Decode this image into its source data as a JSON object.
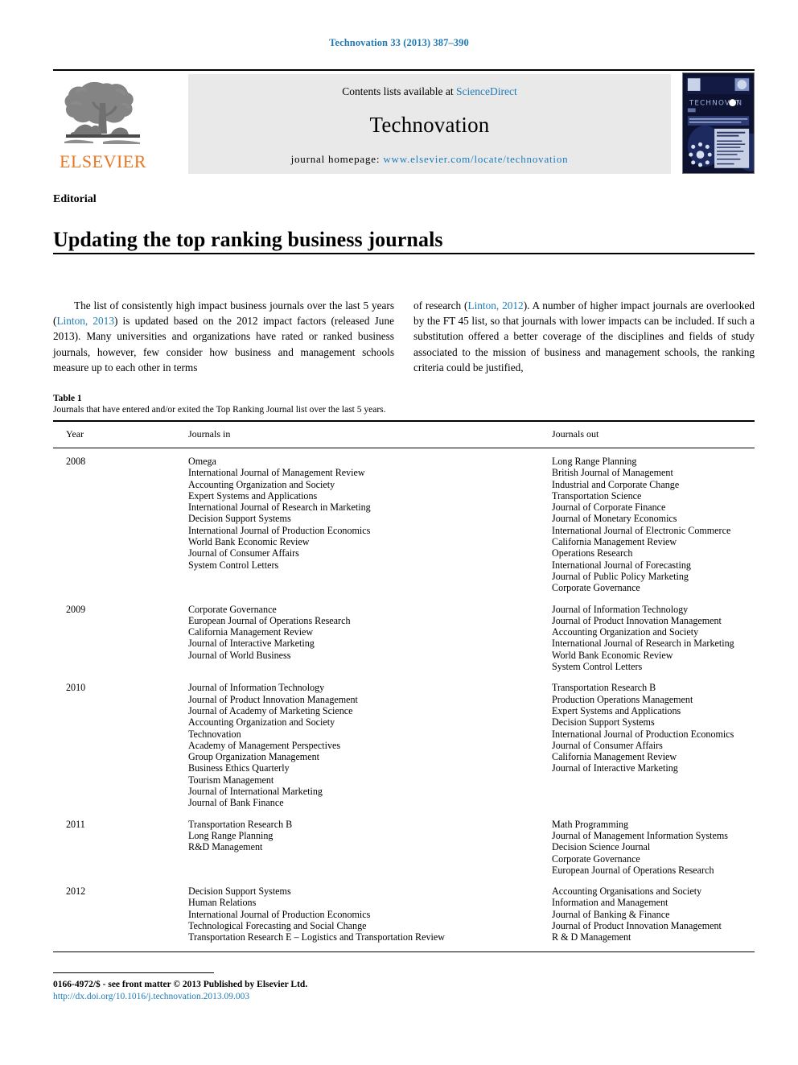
{
  "running_head": "Technovation 33 (2013) 387–390",
  "masthead": {
    "contents_prefix": "Contents lists available at ",
    "contents_link": "ScienceDirect",
    "journal_title": "Technovation",
    "homepage_prefix": "journal homepage: ",
    "homepage_url": "www.elsevier.com/locate/technovation",
    "publisher_wordmark": "ELSEVIER",
    "cover_title": "TECHNOVATION",
    "link_color": "#1f7bb6"
  },
  "article": {
    "type": "Editorial",
    "title": "Updating the top ranking business journals"
  },
  "body": {
    "left_parts": [
      "The list of consistently high impact business journals over the last 5 years (",
      "Linton, 2013",
      ") is updated based on the 2012 impact factors (released June 2013). Many universities and organizations have rated or ranked business journals, however, few consider how business and management schools measure up to each other in terms"
    ],
    "right_parts": [
      "of research (",
      "Linton, 2012",
      "). A number of higher impact journals are overlooked by the FT 45 list, so that journals with lower impacts can be included. If such a substitution offered a better coverage of the disciplines and fields of study associated to the mission of business and management schools, the ranking criteria could be justified,"
    ]
  },
  "table": {
    "label": "Table 1",
    "caption": "Journals that have entered and/or exited the Top Ranking Journal list over the last 5 years.",
    "columns": [
      "Year",
      "Journals in",
      "Journals out"
    ],
    "rows": [
      {
        "year": "2008",
        "journals_in": [
          "Omega",
          "International Journal of Management Review",
          "Accounting Organization and Society",
          "Expert Systems and Applications",
          "International Journal of Research in Marketing",
          "Decision Support Systems",
          "International Journal of Production Economics",
          "World Bank Economic Review",
          "Journal of Consumer Affairs",
          "System Control Letters"
        ],
        "journals_out": [
          "Long Range Planning",
          "British Journal of Management",
          "Industrial and Corporate Change",
          "Transportation Science",
          "Journal of Corporate Finance",
          "Journal of Monetary Economics",
          "International Journal of Electronic Commerce",
          "California Management Review",
          "Operations Research",
          "International Journal of Forecasting",
          "Journal of Public Policy Marketing",
          "Corporate Governance"
        ]
      },
      {
        "year": "2009",
        "journals_in": [
          "Corporate Governance",
          "European Journal of Operations Research",
          "California Management Review",
          "Journal of Interactive Marketing",
          "Journal of World Business"
        ],
        "journals_out": [
          "Journal of Information Technology",
          "Journal of Product Innovation Management",
          "Accounting Organization and Society",
          "International Journal of Research in Marketing",
          "World Bank Economic Review",
          "System Control Letters"
        ]
      },
      {
        "year": "2010",
        "journals_in": [
          "Journal of Information Technology",
          "Journal of Product Innovation Management",
          "Journal of Academy of Marketing Science",
          "Accounting Organization and Society",
          "Technovation",
          "Academy of Management Perspectives",
          "Group Organization Management",
          "Business Ethics Quarterly",
          "Tourism Management",
          "Journal of International Marketing",
          "Journal of Bank Finance"
        ],
        "journals_out": [
          "Transportation Research B",
          "Production Operations Management",
          "Expert Systems and Applications",
          "Decision Support Systems",
          "International Journal of Production Economics",
          "Journal of Consumer Affairs",
          "California Management Review",
          "Journal of Interactive Marketing"
        ]
      },
      {
        "year": "2011",
        "journals_in": [
          "Transportation Research B",
          "Long Range Planning",
          "R&D Management"
        ],
        "journals_out": [
          "Math Programming",
          "Journal of Management Information Systems",
          "Decision Science Journal",
          "Corporate Governance",
          "European Journal of Operations Research"
        ]
      },
      {
        "year": "2012",
        "journals_in": [
          "Decision Support Systems",
          "Human Relations",
          "International Journal of Production Economics",
          "Technological Forecasting and Social Change",
          "Transportation Research E – Logistics and Transportation Review"
        ],
        "journals_out": [
          "Accounting Organisations and Society",
          "Information and Management",
          "Journal of Banking & Finance",
          "Journal of Product Innovation Management",
          "R & D Management"
        ]
      }
    ]
  },
  "footer": {
    "copyright": "0166-4972/$ - see front matter © 2013 Published by Elsevier Ltd.",
    "doi": "http://dx.doi.org/10.1016/j.technovation.2013.09.003"
  }
}
